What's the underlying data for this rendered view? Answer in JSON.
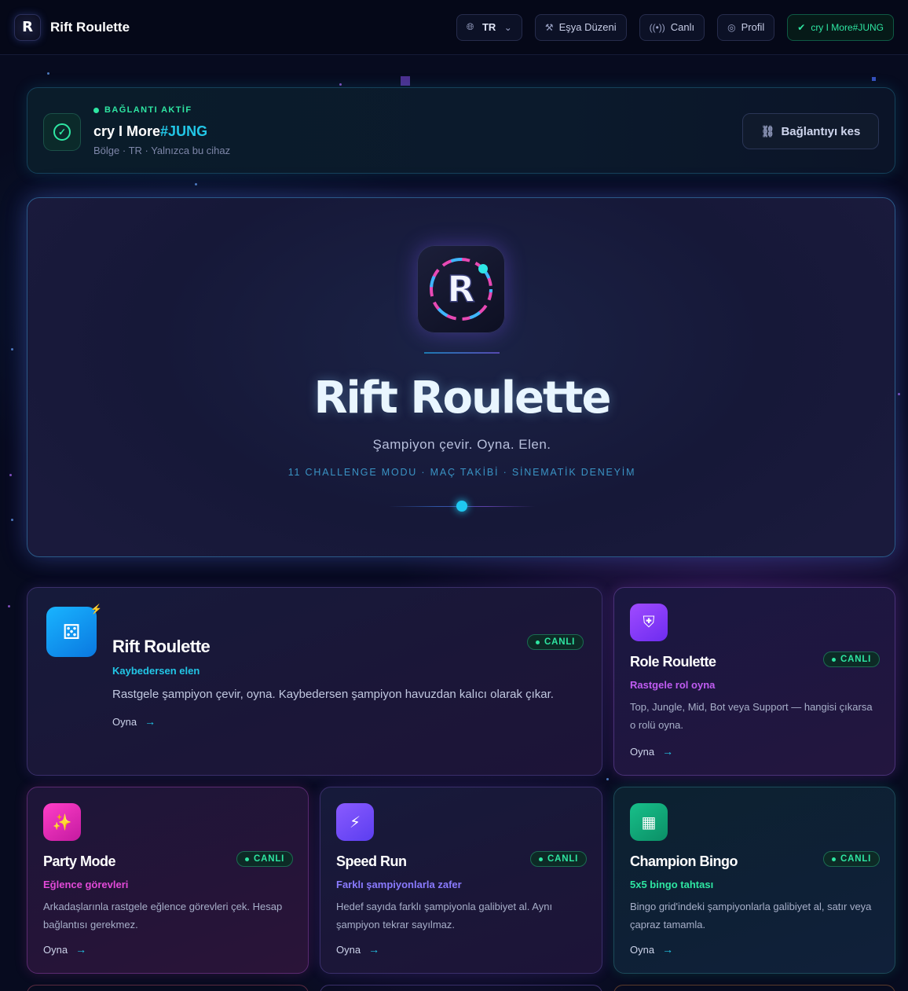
{
  "header": {
    "brand": "Rift Roulette",
    "logo_letter": "R",
    "lang": "TR",
    "nav": [
      {
        "label": "Eşya Düzeni",
        "icon": "hammer-icon"
      },
      {
        "label": "Canlı",
        "icon": "broadcast-icon"
      },
      {
        "label": "Profil",
        "icon": "user-circle-icon"
      }
    ],
    "account": "cry I More#JUNG"
  },
  "connection": {
    "status": "BAĞLANTI AKTİF",
    "name": "cry I More",
    "tag": "#JUNG",
    "details": "Bölge · TR · Yalnızca bu cihaz",
    "disconnect_label": "Bağlantıyı kes"
  },
  "hero": {
    "title": "Rift Roulette",
    "tagline": "Şampiyon  çevir.  Oyna.  Elen.",
    "meta": "11 CHALLENGE MODU · MAÇ TAKİBİ · SİNEMATİK DENEYİM"
  },
  "modes": [
    {
      "title": "Rift Roulette",
      "subtitle": "Kaybedersen elen",
      "description": "Rastgele şampiyon çevir, oyna. Kaybedersen şampiyon havuzdan kalıcı olarak çıkar.",
      "badge": "CANLI",
      "play": "Oyna",
      "icon": "dice-icon",
      "subtitle_color": "#22c6e6"
    },
    {
      "title": "Role Roulette",
      "subtitle": "Rastgele rol oyna",
      "description": "Top, Jungle, Mid, Bot veya Support — hangisi çıkarsa o rolü oyna.",
      "badge": "CANLI",
      "play": "Oyna",
      "icon": "shield-icon",
      "subtitle_color": "#c05cf2"
    },
    {
      "title": "Party Mode",
      "subtitle": "Eğlence görevleri",
      "description": "Arkadaşlarınla rastgele eğlence görevleri çek. Hesap bağlantısı gerekmez.",
      "badge": "CANLI",
      "play": "Oyna",
      "icon": "party-popper-icon",
      "subtitle_color": "#e24ad8"
    },
    {
      "title": "Speed Run",
      "subtitle": "Farklı şampiyonlarla zafer",
      "description": "Hedef sayıda farklı şampiyonla galibiyet al. Aynı şampiyon tekrar sayılmaz.",
      "badge": "CANLI",
      "play": "Oyna",
      "icon": "lightning-icon",
      "subtitle_color": "#8a7bff"
    },
    {
      "title": "Champion Bingo",
      "subtitle": "5x5 bingo tahtası",
      "description": "Bingo grid'indeki şampiyonlarla galibiyet al, satır veya çapraz tamamla.",
      "badge": "CANLI",
      "play": "Oyna",
      "icon": "grid-icon",
      "subtitle_color": "#2ee6a2"
    }
  ]
}
